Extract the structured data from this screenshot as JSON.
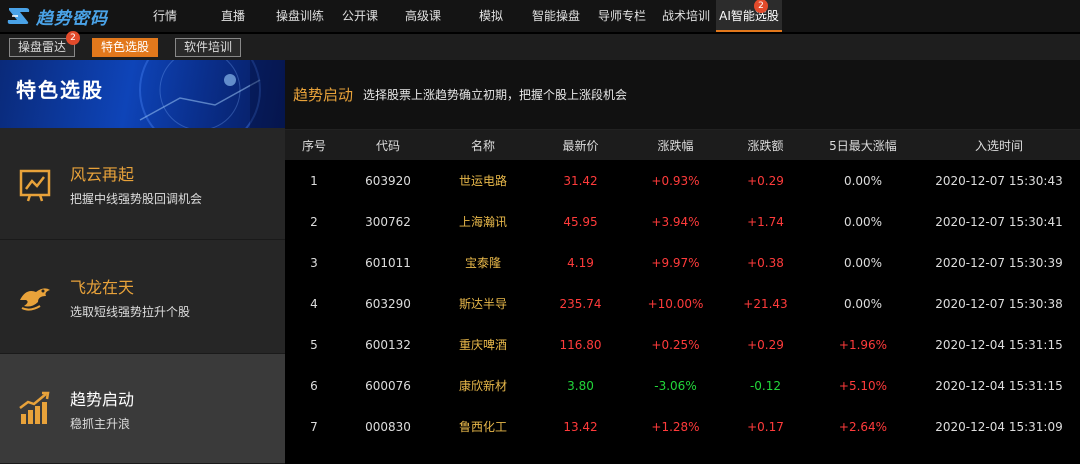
{
  "app": {
    "logo_text": "趋势密码"
  },
  "nav": {
    "items": [
      {
        "label": "行情",
        "width": 66
      },
      {
        "label": "直播",
        "width": 70
      },
      {
        "label": "操盘训练",
        "width": 64
      },
      {
        "label": "公开课",
        "width": 56
      },
      {
        "label": "高级课",
        "width": 70
      },
      {
        "label": "模拟",
        "width": 66
      },
      {
        "label": "智能操盘",
        "width": 64
      },
      {
        "label": "导师专栏",
        "width": 68
      },
      {
        "label": "战术培训",
        "width": 60
      },
      {
        "label": "AI智能选股",
        "width": 66,
        "active": true,
        "badge": "2"
      }
    ]
  },
  "subtabs": [
    {
      "label": "操盘雷达",
      "badge": "2",
      "active": false
    },
    {
      "label": "特色选股",
      "active": true
    },
    {
      "label": "软件培训",
      "active": false
    }
  ],
  "left": {
    "banner_title": "特色选股",
    "features": [
      {
        "title": "风云再起",
        "desc": "把握中线强势股回调机会",
        "icon": "chart-line-icon",
        "selected": false
      },
      {
        "title": "飞龙在天",
        "desc": "选取短线强势拉升个股",
        "icon": "dragon-icon",
        "selected": false
      },
      {
        "title": "趋势启动",
        "desc": "稳抓主升浪",
        "icon": "trend-bars-icon",
        "selected": true
      }
    ]
  },
  "info": {
    "title": "趋势启动",
    "desc": "选择股票上涨趋势确立初期，把握个股上涨段机会"
  },
  "table": {
    "headers": [
      "序号",
      "代码",
      "名称",
      "最新价",
      "涨跌幅",
      "涨跌额",
      "5日最大涨幅",
      "入选时间"
    ],
    "rows": [
      {
        "no": "1",
        "code": "603920",
        "name": "世运电路",
        "price": "31.42",
        "pct": "+0.93%",
        "chg": "+0.29",
        "max5": "0.00%",
        "time": "2020-12-07 15:30:43",
        "dir": "up",
        "max_dir": "flat"
      },
      {
        "no": "2",
        "code": "300762",
        "name": "上海瀚讯",
        "price": "45.95",
        "pct": "+3.94%",
        "chg": "+1.74",
        "max5": "0.00%",
        "time": "2020-12-07 15:30:41",
        "dir": "up",
        "max_dir": "flat"
      },
      {
        "no": "3",
        "code": "601011",
        "name": "宝泰隆",
        "price": "4.19",
        "pct": "+9.97%",
        "chg": "+0.38",
        "max5": "0.00%",
        "time": "2020-12-07 15:30:39",
        "dir": "up",
        "max_dir": "flat"
      },
      {
        "no": "4",
        "code": "603290",
        "name": "斯达半导",
        "price": "235.74",
        "pct": "+10.00%",
        "chg": "+21.43",
        "max5": "0.00%",
        "time": "2020-12-07 15:30:38",
        "dir": "up",
        "max_dir": "flat"
      },
      {
        "no": "5",
        "code": "600132",
        "name": "重庆啤酒",
        "price": "116.80",
        "pct": "+0.25%",
        "chg": "+0.29",
        "max5": "+1.96%",
        "time": "2020-12-04 15:31:15",
        "dir": "up",
        "max_dir": "up"
      },
      {
        "no": "6",
        "code": "600076",
        "name": "康欣新材",
        "price": "3.80",
        "pct": "-3.06%",
        "chg": "-0.12",
        "max5": "+5.10%",
        "time": "2020-12-04 15:31:15",
        "dir": "down",
        "max_dir": "up"
      },
      {
        "no": "7",
        "code": "000830",
        "name": "鲁西化工",
        "price": "13.42",
        "pct": "+1.28%",
        "chg": "+0.17",
        "max5": "+2.64%",
        "time": "2020-12-04 15:31:09",
        "dir": "up",
        "max_dir": "up"
      }
    ]
  },
  "colors": {
    "accent": "#e2781c",
    "up": "#ff3b3b",
    "down": "#22d63a",
    "name": "#e8b84a"
  }
}
